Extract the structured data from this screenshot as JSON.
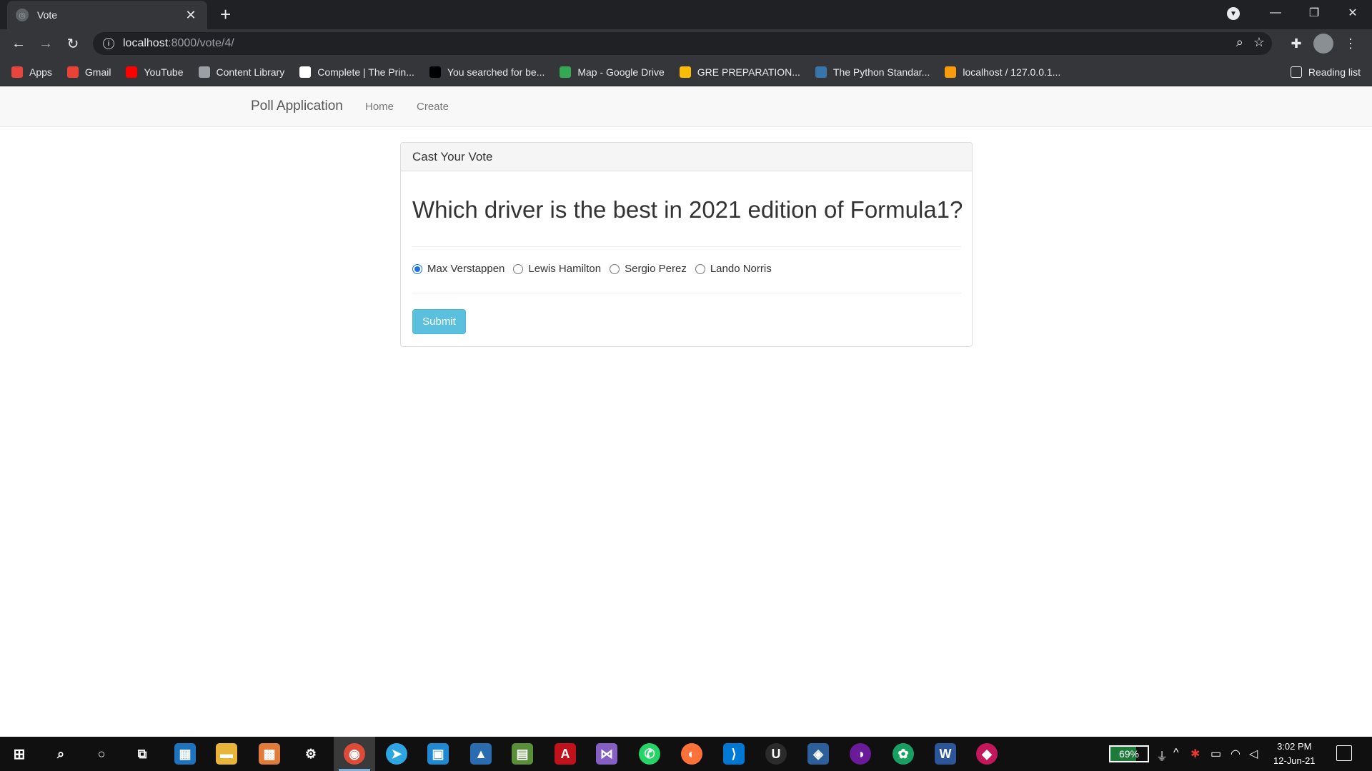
{
  "browser": {
    "tab_title": "Vote",
    "tab_close": "✕",
    "new_tab": "+",
    "url_host": "localhost",
    "url_rest": ":8000/vote/4/",
    "bookmarks": [
      {
        "label": "Apps",
        "icon": "apps-grid-icon",
        "color": "#e8453c"
      },
      {
        "label": "Gmail",
        "icon": "gmail-icon",
        "color": "#ea4335"
      },
      {
        "label": "YouTube",
        "icon": "youtube-icon",
        "color": "#ff0000"
      },
      {
        "label": "Content Library",
        "icon": "content-library-icon",
        "color": "#9aa0a6"
      },
      {
        "label": "Complete | The Prin...",
        "icon": "p-icon",
        "color": "#ffffff"
      },
      {
        "label": "You searched for be...",
        "icon": "g-icon",
        "color": "#000000"
      },
      {
        "label": "Map - Google Drive",
        "icon": "google-drive-icon",
        "color": "#34a853"
      },
      {
        "label": "GRE PREPARATION...",
        "icon": "google-drive-icon",
        "color": "#fbbc04"
      },
      {
        "label": "The Python Standar...",
        "icon": "python-icon",
        "color": "#3776ab"
      },
      {
        "label": "localhost / 127.0.0.1...",
        "icon": "phpmyadmin-icon",
        "color": "#f89c0e"
      }
    ],
    "reading_list": "Reading list"
  },
  "navbar": {
    "brand": "Poll Application",
    "links": [
      "Home",
      "Create"
    ]
  },
  "poll": {
    "panel_title": "Cast Your Vote",
    "question": "Which driver is the best in 2021 edition of Formula1?",
    "options": [
      "Max Verstappen",
      "Lewis Hamilton",
      "Sergio Perez",
      "Lando Norris"
    ],
    "selected_option": "Max Verstappen",
    "submit_label": "Submit",
    "accent_color": "#5bc0de"
  },
  "taskbar": {
    "battery": "69%",
    "time": "3:02 PM",
    "date": "12-Jun-21"
  }
}
